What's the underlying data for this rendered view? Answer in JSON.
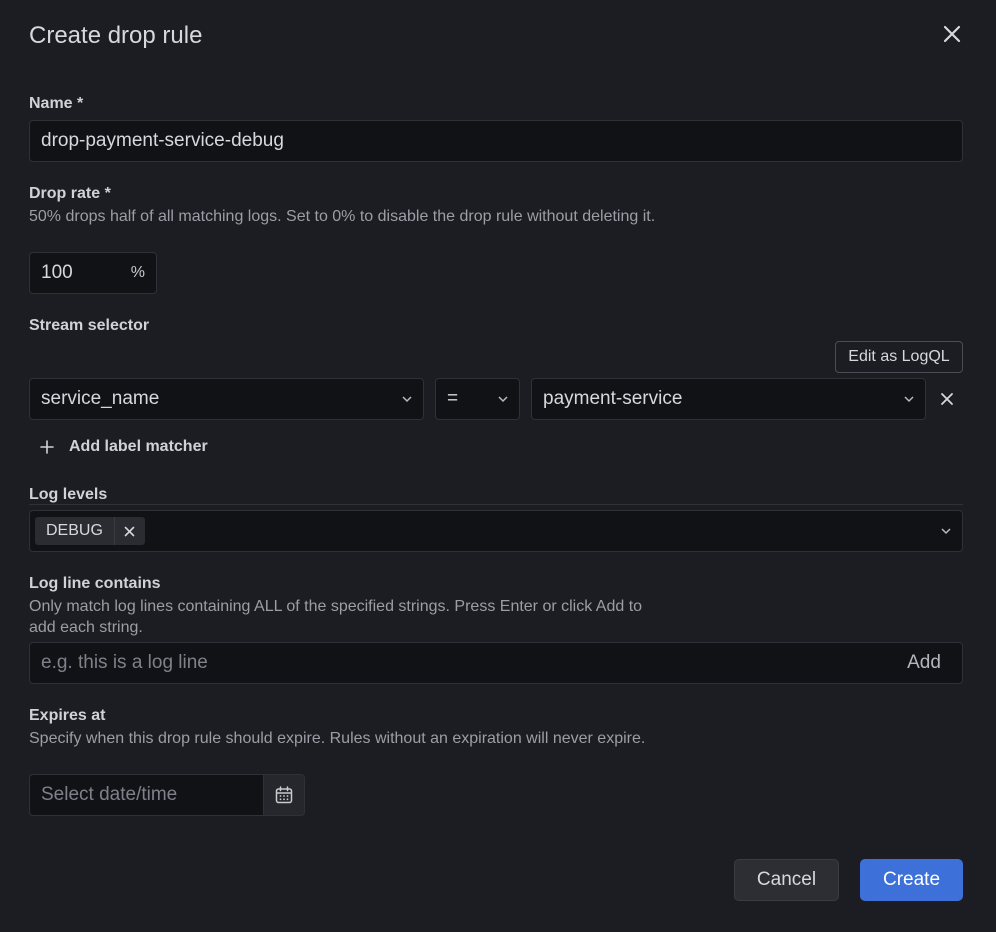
{
  "modal": {
    "title": "Create drop rule"
  },
  "name_field": {
    "label": "Name *",
    "value": "drop-payment-service-debug"
  },
  "drop_rate": {
    "label": "Drop rate *",
    "description": "50% drops half of all matching logs. Set to 0% to disable the drop rule without deleting it.",
    "value": "100",
    "unit": "%"
  },
  "stream_selector": {
    "label": "Stream selector",
    "edit_logql_label": "Edit as LogQL",
    "matcher": {
      "label_name": "service_name",
      "operator": "=",
      "label_value": "payment-service"
    },
    "add_matcher_label": "Add label matcher"
  },
  "log_levels": {
    "label": "Log levels",
    "selected": [
      "DEBUG"
    ]
  },
  "log_line_contains": {
    "label": "Log line contains",
    "description": "Only match log lines containing ALL of the specified strings. Press Enter or click Add to add each string.",
    "placeholder": "e.g. this is a log line",
    "add_label": "Add"
  },
  "expires_at": {
    "label": "Expires at",
    "description": "Specify when this drop rule should expire. Rules without an expiration will never expire.",
    "placeholder": "Select date/time"
  },
  "footer": {
    "cancel_label": "Cancel",
    "create_label": "Create"
  },
  "colors": {
    "background": "#1c1d22",
    "input_background": "#111216",
    "primary": "#3d71d9"
  }
}
